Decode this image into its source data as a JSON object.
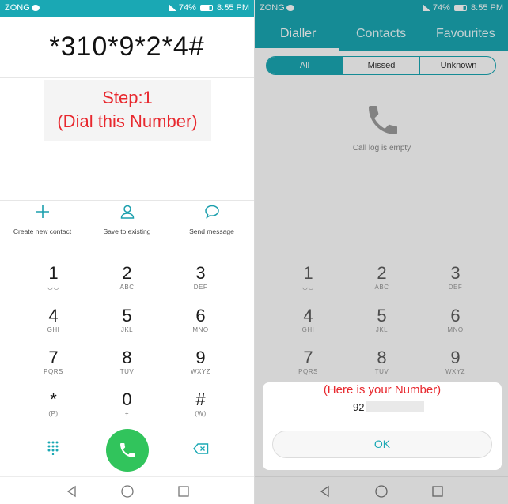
{
  "left": {
    "status": {
      "carrier": "ZONG",
      "battery": "74%",
      "time": "8:55 PM"
    },
    "dialed_number": "*310*9*2*4#",
    "annotation": {
      "line1": "Step:1",
      "line2": "(Dial this Number)"
    },
    "actions": [
      {
        "label": "Create new contact",
        "icon": "plus-icon"
      },
      {
        "label": "Save to existing",
        "icon": "person-icon"
      },
      {
        "label": "Send message",
        "icon": "message-bubble-icon"
      }
    ],
    "keys": [
      {
        "num": "1",
        "letters": ""
      },
      {
        "num": "2",
        "letters": "ABC"
      },
      {
        "num": "3",
        "letters": "DEF"
      },
      {
        "num": "4",
        "letters": "GHI"
      },
      {
        "num": "5",
        "letters": "JKL"
      },
      {
        "num": "6",
        "letters": "MNO"
      },
      {
        "num": "7",
        "letters": "PQRS"
      },
      {
        "num": "8",
        "letters": "TUV"
      },
      {
        "num": "9",
        "letters": "WXYZ"
      },
      {
        "num": "*",
        "letters": "(P)"
      },
      {
        "num": "0",
        "letters": "+"
      },
      {
        "num": "#",
        "letters": "(W)"
      }
    ]
  },
  "right": {
    "status": {
      "carrier": "ZONG",
      "battery": "74%",
      "time": "8:55 PM"
    },
    "tabs": [
      "Dialler",
      "Contacts",
      "Favourites"
    ],
    "filters": [
      "All",
      "Missed",
      "Unknown"
    ],
    "empty_message": "Call log is empty",
    "keys": [
      {
        "num": "1",
        "letters": ""
      },
      {
        "num": "2",
        "letters": "ABC"
      },
      {
        "num": "3",
        "letters": "DEF"
      },
      {
        "num": "4",
        "letters": "GHI"
      },
      {
        "num": "5",
        "letters": "JKL"
      },
      {
        "num": "6",
        "letters": "MNO"
      },
      {
        "num": "7",
        "letters": "PQRS"
      },
      {
        "num": "8",
        "letters": "TUV"
      },
      {
        "num": "9",
        "letters": "WXYZ"
      }
    ],
    "dialog": {
      "annotation": "(Here is your Number)",
      "number_prefix": "92",
      "ok_label": "OK"
    }
  },
  "colors": {
    "accent": "#1aa8b4",
    "call_green": "#31c45c",
    "annotation_red": "#e8282e"
  }
}
